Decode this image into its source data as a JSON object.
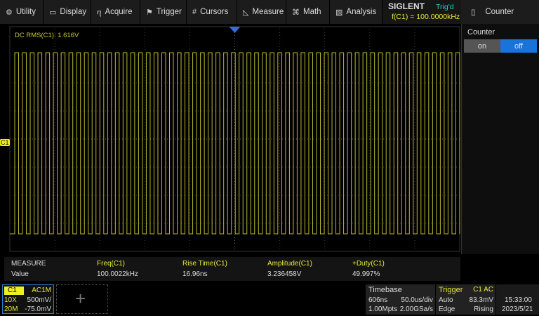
{
  "menu": [
    {
      "icon": "gear-icon",
      "label": "Utility"
    },
    {
      "icon": "display-icon",
      "label": "Display"
    },
    {
      "icon": "acquire-icon",
      "label": "Acquire"
    },
    {
      "icon": "flag-icon",
      "label": "Trigger"
    },
    {
      "icon": "cursors-icon",
      "label": "Cursors"
    },
    {
      "icon": "measure-icon",
      "label": "Measure"
    },
    {
      "icon": "math-icon",
      "label": "Math"
    },
    {
      "icon": "analysis-icon",
      "label": "Analysis"
    }
  ],
  "brand": {
    "logo": "SIGLENT",
    "status": "Trig'd",
    "freq": "f(C1) = 100.0000kHz"
  },
  "counter": {
    "title": "Counter",
    "label": "Counter",
    "on": "on",
    "off": "off",
    "selected": "off"
  },
  "screen": {
    "dc_rms": "DC RMS(C1): 1.616V",
    "channel_marker": "C1",
    "trace_color": "#e8e83a",
    "frequency_khz": 100,
    "timebase_us_per_div": 50
  },
  "measure": {
    "header": "MEASURE",
    "row_label": "Value",
    "items": [
      {
        "name": "Freq(C1)",
        "value": "100.0022kHz"
      },
      {
        "name": "Rise Time(C1)",
        "value": "16.96ns"
      },
      {
        "name": "Amplitude(C1)",
        "value": "3.236458V"
      },
      {
        "name": "+Duty(C1)",
        "value": "49.997%"
      }
    ]
  },
  "channel": {
    "name": "C1",
    "coupling": "AC1M",
    "probe": "10X",
    "scale": "500mV/",
    "bw": "20M",
    "offset": "-75.0mV"
  },
  "timebase": {
    "title": "Timebase",
    "delay": "606ns",
    "scale": "50.0us/div",
    "points": "1.00Mpts",
    "rate": "2.00GSa/s"
  },
  "trigger": {
    "title": "Trigger",
    "source": "C1 AC",
    "mode": "Auto",
    "level": "83.3mV",
    "type": "Edge",
    "slope": "Rising"
  },
  "clock": {
    "time": "15:33:00",
    "date": "2023/5/21"
  }
}
